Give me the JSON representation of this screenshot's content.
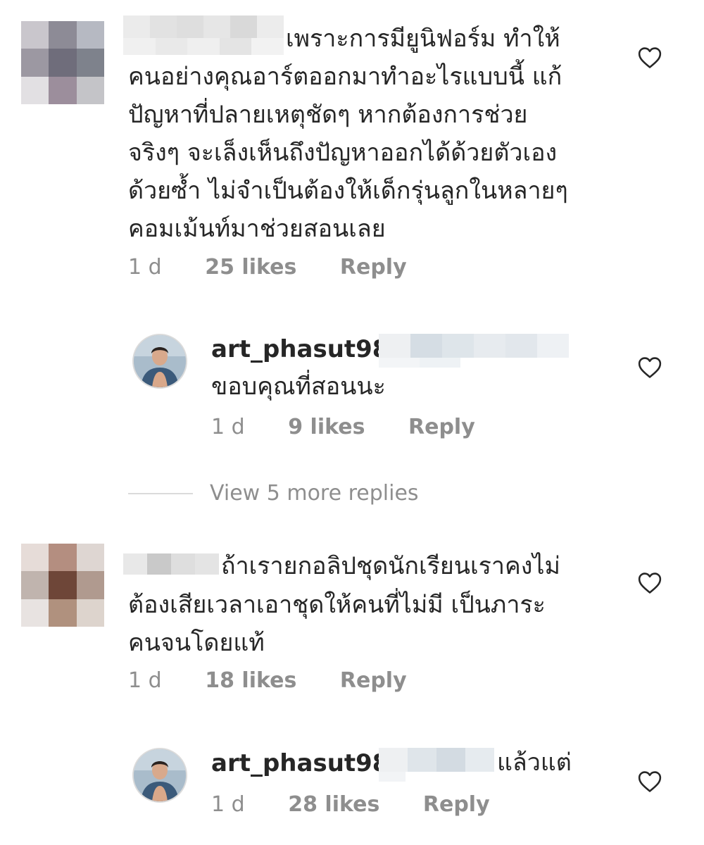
{
  "comments": [
    {
      "text_lines": [
        "เพราะการมียูนิฟอร์ม ทำให้",
        "คนอย่างคุณอาร์ตออกมาทำอะไรแบบนี้ แก้",
        "ปัญหาที่ปลายเหตุชัดๆ หากต้องการช่วย",
        "จริงๆ จะเล็งเห็นถึงปัญหาออกได้ด้วยตัวเอง",
        "ด้วยซ้ำ ไม่จำเป็นต้องให้เด็กรุ่นลูกในหลายๆ",
        "คอมเม้นท์มาช่วยสอนเลย"
      ],
      "time": "1 d",
      "likes": "25 likes",
      "reply": "Reply",
      "reply_item": {
        "username": "art_phasut98",
        "text": "ขอบคุณที่สอนนะ",
        "time": "1 d",
        "likes": "9 likes",
        "reply": "Reply"
      },
      "view_more": "View 5 more replies"
    },
    {
      "text_lines": [
        "ถ้าเรายกอลิปชุดนักเรียนเราคงไม่",
        "ต้องเสียเวลาเอาชุดให้คนที่ไม่มี เป็นภาระ",
        "คนจนโดยแท้"
      ],
      "time": "1 d",
      "likes": "18 likes",
      "reply": "Reply",
      "reply_item": {
        "username": "art_phasut98",
        "text": "แล้วแต่",
        "time": "1 d",
        "likes": "28 likes",
        "reply": "Reply"
      }
    }
  ],
  "colors": {
    "text": "#262626",
    "meta": "#8e8e8e",
    "divider": "#dbdbdb"
  },
  "icons": [
    "heart-icon"
  ]
}
